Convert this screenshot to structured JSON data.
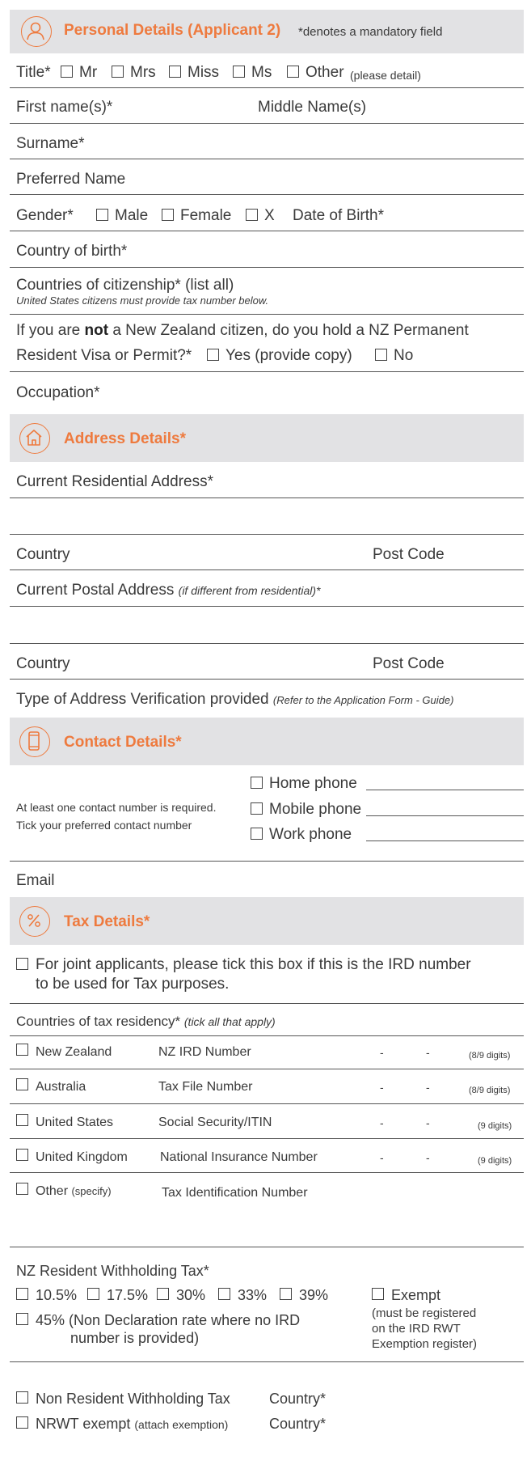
{
  "sections": {
    "personal": {
      "title": "Personal Details (Applicant 2)",
      "note": "*denotes a mandatory field",
      "icon": "person-icon"
    },
    "address": {
      "title": "Address Details*",
      "icon": "house-icon"
    },
    "contact": {
      "title": "Contact Details*",
      "icon": "mobile-phone-icon"
    },
    "tax": {
      "title": "Tax Details*",
      "icon": "percent-icon"
    }
  },
  "title_row": {
    "label": "Title*",
    "options": [
      "Mr",
      "Mrs",
      "Miss",
      "Ms",
      "Other"
    ],
    "other_note": "(please detail)"
  },
  "fields": {
    "first_name": "First name(s)*",
    "middle_name": "Middle Name(s)",
    "surname": "Surname*",
    "preferred_name": "Preferred Name",
    "gender": "Gender*",
    "gender_options": [
      "Male",
      "Female",
      "X"
    ],
    "dob": "Date of Birth*",
    "country_of_birth": "Country of birth*",
    "citizenship": "Countries of citizenship* (list all)",
    "citizenship_note": "United States citizens must provide tax number below.",
    "pr_q_pre": "If you are ",
    "pr_q_bold": "not",
    "pr_q_post": " a New Zealand citizen, do you hold a NZ Permanent",
    "pr_q_line2": "Resident Visa or Permit?*",
    "pr_yes": "Yes (provide copy)",
    "pr_no": "No",
    "occupation": "Occupation*"
  },
  "address": {
    "residential": "Current Residential Address*",
    "country": "Country",
    "post_code": "Post Code",
    "postal": "Current Postal Address",
    "postal_note": "(if different from residential)*",
    "verification": "Type of Address Verification provided",
    "verification_note": "(Refer to the Application Form - Guide)"
  },
  "contact": {
    "note_line1": "At least one contact number is required.",
    "note_line2": "Tick your preferred contact number",
    "phones": [
      "Home phone",
      "Mobile phone",
      "Work phone"
    ],
    "email": "Email"
  },
  "tax": {
    "joint_line1": "For joint applicants, please tick this box if this is the IRD number",
    "joint_line2": "to be used for Tax purposes.",
    "residency": "Countries of tax residency*",
    "residency_note": "(tick all that apply)",
    "rows": [
      {
        "country": "New Zealand",
        "id_label": "NZ IRD Number",
        "digits": "(8/9 digits)"
      },
      {
        "country": "Australia",
        "id_label": "Tax File Number",
        "digits": "(8/9 digits)"
      },
      {
        "country": "United States",
        "id_label": "Social Security/ITIN",
        "digits": "(9 digits)"
      },
      {
        "country": "United Kingdom",
        "id_label": "National Insurance Number",
        "digits": "(9 digits)"
      }
    ],
    "dash": "-",
    "other": "Other",
    "other_note": "(specify)",
    "other_id": "Tax Identification Number",
    "rwt_title": "NZ Resident Withholding Tax*",
    "rates": [
      "10.5%",
      "17.5%",
      "30%",
      "33%",
      "39%"
    ],
    "rate_45_line1": "45% (Non Declaration rate where no IRD",
    "rate_45_line2": "number is provided)",
    "exempt": "Exempt",
    "exempt_note": [
      "(must be registered",
      "on the IRD RWT",
      "Exemption register)"
    ],
    "nrwt": "Non Resident Withholding Tax",
    "nrwt_exempt": "NRWT exempt",
    "nrwt_exempt_note": "(attach exemption)",
    "country": "Country*"
  },
  "colors": {
    "accent": "#ee7a3e",
    "header_bg": "#e2e2e4",
    "text": "#3a3a3a"
  }
}
